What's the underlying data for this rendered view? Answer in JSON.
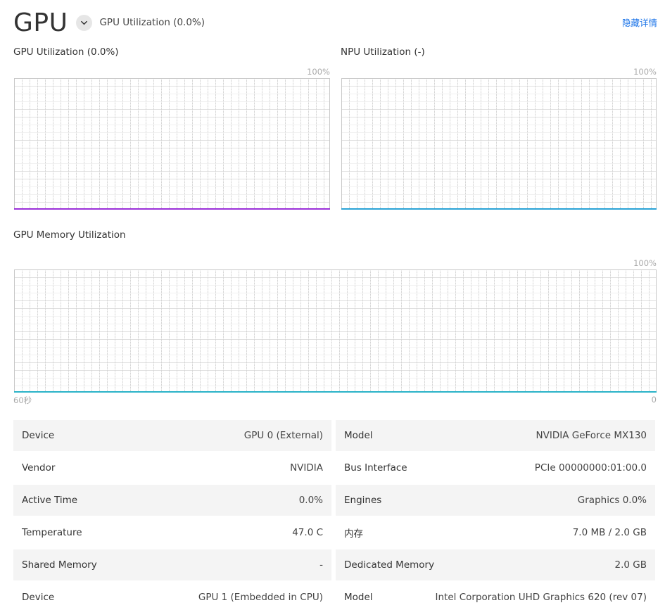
{
  "header": {
    "title": "GPU",
    "subtitle": "GPU Utilization (0.0%)",
    "hide_details": "隐藏详情"
  },
  "charts": {
    "gpu_util": {
      "label": "GPU Utilization (0.0%)",
      "max_label": "100%",
      "color": "#9b30d9"
    },
    "npu_util": {
      "label": "NPU Utilization (-)",
      "max_label": "100%",
      "color": "#29a3d6"
    },
    "gpu_mem": {
      "label": "GPU Memory Utilization",
      "max_label": "100%",
      "color": "#2bb3c8",
      "x_start": "60秒",
      "x_end": "0"
    }
  },
  "chart_data": [
    {
      "type": "line",
      "title": "GPU Utilization (0.0%)",
      "ylim": [
        0,
        100
      ],
      "series": [
        {
          "name": "GPU Utilization",
          "values": [
            0,
            0,
            0,
            0,
            0,
            0,
            0,
            0,
            0,
            0,
            0,
            0,
            0,
            0,
            0,
            0,
            0,
            0,
            0,
            0,
            0,
            0,
            0,
            0,
            0,
            0,
            0,
            0,
            0,
            0,
            0,
            0,
            0,
            0,
            0,
            0,
            0,
            0,
            0,
            0,
            0,
            0,
            0,
            0,
            0,
            0,
            0,
            0,
            0,
            0,
            0,
            0,
            0,
            0,
            0,
            0,
            0,
            0,
            0,
            0
          ]
        }
      ]
    },
    {
      "type": "line",
      "title": "NPU Utilization (-)",
      "ylim": [
        0,
        100
      ],
      "series": [
        {
          "name": "NPU Utilization",
          "values": [
            0,
            0,
            0,
            0,
            0,
            0,
            0,
            0,
            0,
            0,
            0,
            0,
            0,
            0,
            0,
            0,
            0,
            0,
            0,
            0,
            0,
            0,
            0,
            0,
            0,
            0,
            0,
            0,
            0,
            0,
            0,
            0,
            0,
            0,
            0,
            0,
            0,
            0,
            0,
            0,
            0,
            0,
            0,
            0,
            0,
            0,
            0,
            0,
            0,
            0,
            0,
            0,
            0,
            0,
            0,
            0,
            0,
            0,
            0,
            0
          ]
        }
      ]
    },
    {
      "type": "line",
      "title": "GPU Memory Utilization",
      "ylim": [
        0,
        100
      ],
      "x": [
        "60秒",
        "0"
      ],
      "series": [
        {
          "name": "GPU Memory Utilization",
          "values": [
            0,
            0,
            0,
            0,
            0,
            0,
            0,
            0,
            0,
            0,
            0,
            0,
            0,
            0,
            0,
            0,
            0,
            0,
            0,
            0,
            0,
            0,
            0,
            0,
            0,
            0,
            0,
            0,
            0,
            0,
            0,
            0,
            0,
            0,
            0,
            0,
            0,
            0,
            0,
            0,
            0,
            0,
            0,
            0,
            0,
            0,
            0,
            0,
            0,
            0,
            0,
            0,
            0,
            0,
            0,
            0,
            0,
            0,
            0,
            0
          ]
        }
      ]
    }
  ],
  "info": [
    {
      "lk": "Device",
      "lv": "GPU 0 (External)",
      "rk": "Model",
      "rv": "NVIDIA GeForce MX130"
    },
    {
      "lk": "Vendor",
      "lv": "NVIDIA",
      "rk": "Bus Interface",
      "rv": "PCIe 00000000:01:00.0"
    },
    {
      "lk": "Active Time",
      "lv": "0.0%",
      "rk": "Engines",
      "rv": "Graphics 0.0%"
    },
    {
      "lk": "Temperature",
      "lv": "47.0 C",
      "rk": "内存",
      "rv": "7.0 MB / 2.0 GB"
    },
    {
      "lk": "Shared Memory",
      "lv": "-",
      "rk": "Dedicated Memory",
      "rv": "2.0 GB"
    },
    {
      "lk": "Device",
      "lv": "GPU 1 (Embedded in CPU)",
      "rk": "Model",
      "rv": "Intel Corporation UHD Graphics 620 (rev 07)"
    }
  ]
}
